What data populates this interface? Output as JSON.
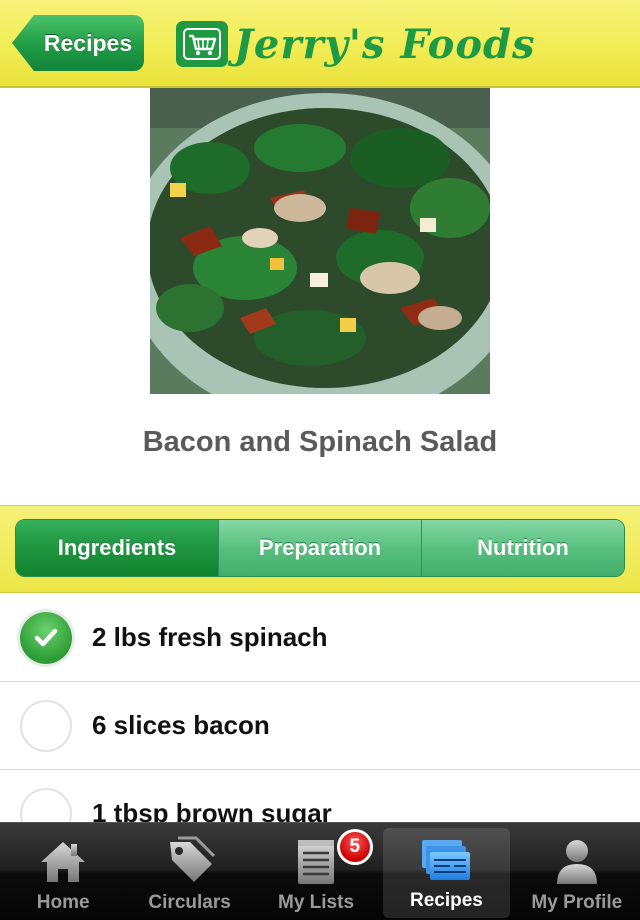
{
  "header": {
    "back_label": "Recipes",
    "brand_name": "Jerry's Foods"
  },
  "recipe": {
    "title": "Bacon and Spinach Salad"
  },
  "tabs": [
    {
      "label": "Ingredients",
      "active": true
    },
    {
      "label": "Preparation",
      "active": false
    },
    {
      "label": "Nutrition",
      "active": false
    }
  ],
  "ingredients": [
    {
      "label": "2 lbs fresh spinach",
      "checked": true
    },
    {
      "label": "6 slices bacon",
      "checked": false
    },
    {
      "label": "1 tbsp brown sugar",
      "checked": false
    }
  ],
  "tabbar": {
    "items": [
      {
        "label": "Home",
        "icon": "home-icon",
        "active": false
      },
      {
        "label": "Circulars",
        "icon": "tag-icon",
        "active": false
      },
      {
        "label": "My Lists",
        "icon": "notepad-icon",
        "active": false,
        "badge": "5"
      },
      {
        "label": "Recipes",
        "icon": "recipe-cards-icon",
        "active": true
      },
      {
        "label": "My Profile",
        "icon": "person-icon",
        "active": false
      }
    ]
  },
  "colors": {
    "brand_green": "#1c9a45",
    "header_yellow": "#f1ec55",
    "badge_red": "#cc0000"
  }
}
